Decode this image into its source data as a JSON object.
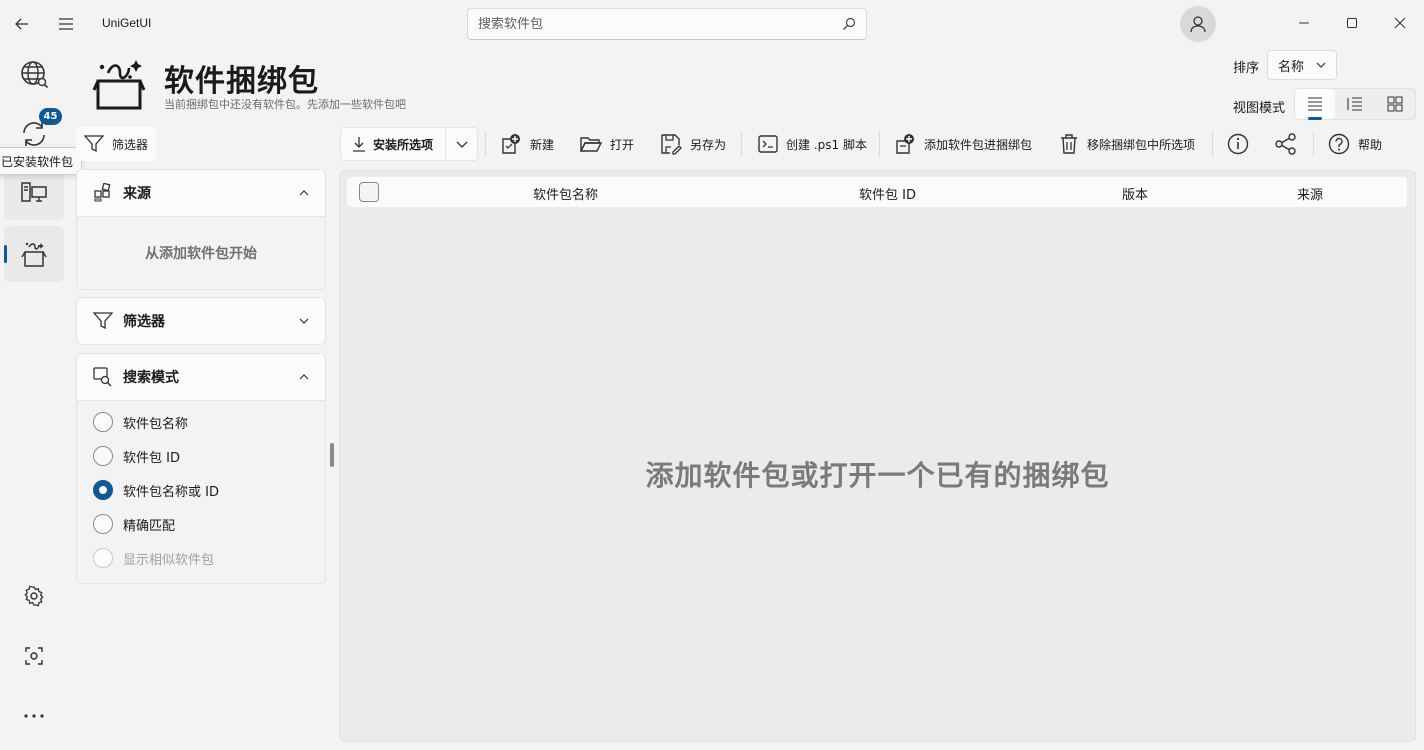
{
  "app": {
    "title": "UniGetUI"
  },
  "search": {
    "placeholder": "搜索软件包"
  },
  "rail": {
    "updates_badge": "45",
    "tooltip": "已安装软件包"
  },
  "header": {
    "title": "软件捆绑包",
    "subtitle": "当前捆绑包中还没有软件包。先添加一些软件包吧",
    "sort_label": "排序",
    "sort_value": "名称",
    "view_label": "视图模式"
  },
  "filter_toggle": {
    "label": "筛选器"
  },
  "panels": {
    "sources": {
      "title": "来源",
      "empty": "从添加软件包开始"
    },
    "filters": {
      "title": "筛选器"
    },
    "search_mode": {
      "title": "搜索模式",
      "options": [
        "软件包名称",
        "软件包 ID",
        "软件包名称或 ID",
        "精确匹配",
        "显示相似软件包"
      ],
      "selected_index": 2,
      "disabled_index": 4
    }
  },
  "toolbar": {
    "install_selected": "安装所选项",
    "new": "新建",
    "open": "打开",
    "save_as": "另存为",
    "create_script": "创建 .ps1 脚本",
    "add_to_bundle": "添加软件包进捆绑包",
    "remove_selected": "移除捆绑包中所选项",
    "help": "帮助"
  },
  "table": {
    "columns": [
      "软件包名称",
      "软件包 ID",
      "版本",
      "来源"
    ],
    "empty_message": "添加软件包或打开一个已有的捆绑包"
  },
  "colors": {
    "accent": "#0f5a95"
  }
}
